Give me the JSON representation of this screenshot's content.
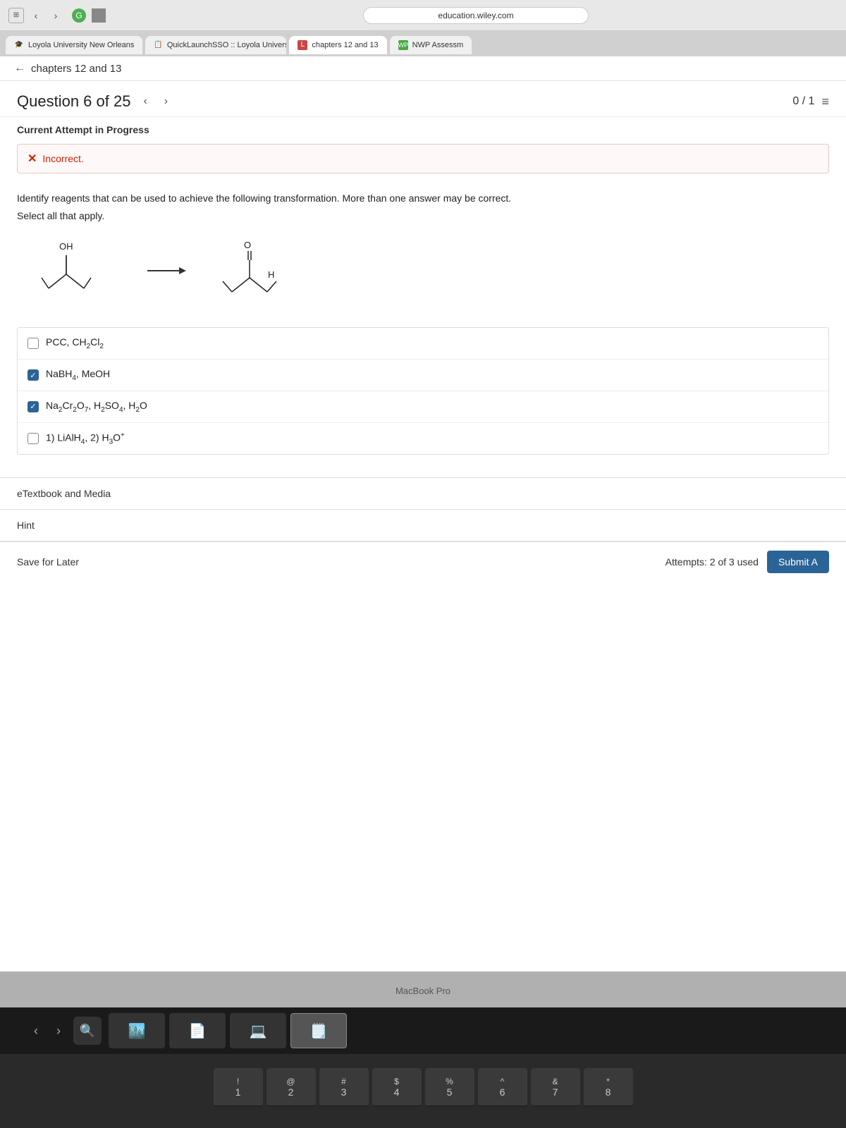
{
  "browser": {
    "address": "education.wiley.com",
    "tabs": [
      {
        "id": "tab1",
        "label": "Loyola University New Orleans",
        "favicon": "🎓",
        "active": false
      },
      {
        "id": "tab2",
        "label": "QuickLaunchSSO :: Loyola University Ne...",
        "favicon": "📋",
        "active": false
      },
      {
        "id": "tab3",
        "label": "chapters 12 and 13",
        "favicon": "L",
        "active": true
      },
      {
        "id": "tab4",
        "label": "NWP Assessm",
        "favicon": "W",
        "active": false
      }
    ]
  },
  "nav": {
    "back_label": "chapters 12 and 13"
  },
  "question": {
    "title": "Question 6 of 25",
    "score": "0 / 1",
    "attempt_label": "Current Attempt in Progress",
    "feedback": "Incorrect.",
    "text": "Identify reagents that can be used to achieve the following transformation. More than one answer may be correct.",
    "select_label": "Select all that apply.",
    "choices": [
      {
        "id": "c1",
        "text": "PCC, CH₂Cl₂",
        "checked": false
      },
      {
        "id": "c2",
        "text": "NaBH₄, MeOH",
        "checked": true
      },
      {
        "id": "c3",
        "text": "Na₂Cr₂O₇, H₂SO₄, H₂O",
        "checked": true
      },
      {
        "id": "c4",
        "text": "1) LiAlH₄, 2) H₃O⁺",
        "checked": false
      }
    ]
  },
  "footer": {
    "etextbook_label": "eTextbook and Media",
    "hint_label": "Hint"
  },
  "bottom_bar": {
    "save_later": "Save for Later",
    "attempts": "Attempts: 2 of 3 used",
    "submit": "Submit A"
  },
  "macbook": {
    "label": "MacBook Pro"
  },
  "keyboard": {
    "rows": [
      [
        {
          "top": "!",
          "bottom": "1"
        },
        {
          "top": "@",
          "bottom": "2"
        },
        {
          "top": "#",
          "bottom": "3"
        },
        {
          "top": "$",
          "bottom": "4"
        },
        {
          "top": "%",
          "bottom": "5"
        },
        {
          "top": "^",
          "bottom": "6"
        },
        {
          "top": "&",
          "bottom": "7"
        },
        {
          "top": "*",
          "bottom": "8"
        }
      ]
    ]
  }
}
